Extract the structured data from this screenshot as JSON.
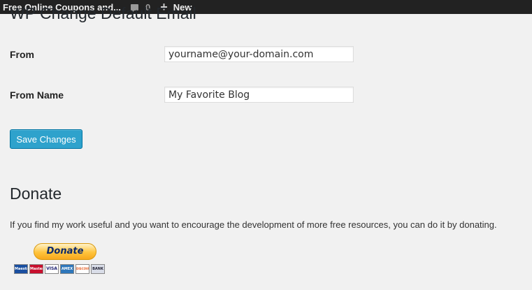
{
  "adminbar": {
    "site_name": "Free Online Coupons and...",
    "comment_count": "0",
    "new_label": "New"
  },
  "page": {
    "title": "WP Change Default Email"
  },
  "form": {
    "from_label": "From",
    "from_value": "yourname@your-domain.com",
    "from_name_label": "From Name",
    "from_name_value": "My Favorite Blog",
    "save_label": "Save Changes"
  },
  "donate": {
    "title": "Donate",
    "text": "If you find my work useful and you want to encourage the development of more free resources, you can do it by donating.",
    "button_label": "Donate",
    "cards": [
      {
        "name": "maestro-card-icon",
        "label": "Maestro",
        "color": "#1a4fa0"
      },
      {
        "name": "mastercard-icon",
        "label": "MasterCard",
        "color": "#c8102e"
      },
      {
        "name": "visa-card-icon",
        "label": "VISA",
        "color": "#ffffff"
      },
      {
        "name": "amex-card-icon",
        "label": "AMEX",
        "color": "#2e77bb"
      },
      {
        "name": "discover-card-icon",
        "label": "DISCOVER",
        "color": "#ffffff"
      },
      {
        "name": "bank-card-icon",
        "label": "BANK",
        "color": "#d9dde8"
      }
    ]
  }
}
